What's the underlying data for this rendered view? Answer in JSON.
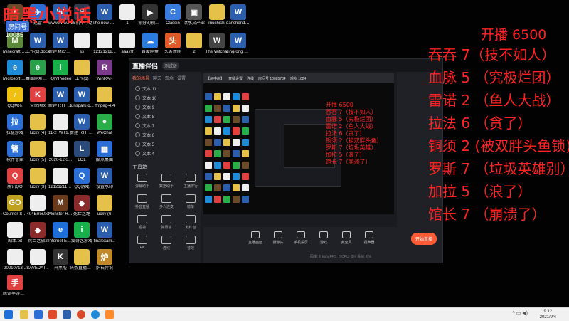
{
  "overlay": {
    "title": "暗黑小说话",
    "room_badge": "房间号",
    "room_number": "10085"
  },
  "scoreboard": {
    "header": "开播 6500",
    "rows": [
      "吞吞 7（技不如人）",
      "血脉 5 （究极烂团）",
      "雷诺 2 （鱼人大战）",
      "拉法 6 （贪了）",
      "铜须 2 (被双胖头鱼锁)",
      "罗斯 7 （垃圾英雄别）",
      "加拉 5 （浪了）",
      "馆长 7 （崩溃了）"
    ]
  },
  "desktop_icons": [
    {
      "label": "Thy Are Billions",
      "color": "#6b4a2a",
      "glyph": "T"
    },
    {
      "label": "迅雷",
      "color": "#2b6fd6",
      "glyph": "✈"
    },
    {
      "label": "wwwwww.d...",
      "color": "#2b5fae",
      "glyph": "W"
    },
    {
      "label": "65机甲行动",
      "color": "#2e3a4e",
      "glyph": "S"
    },
    {
      "label": "The new green rev...",
      "color": "#2b5fae",
      "glyph": "W"
    },
    {
      "label": "1",
      "color": "#eeeeee",
      "glyph": ""
    },
    {
      "label": "零分的视频实录.mp4",
      "color": "#333333",
      "glyph": "▶"
    },
    {
      "label": "Classin",
      "color": "#3a7be0",
      "glyph": "C"
    },
    {
      "label": "洪水文产业",
      "color": "#555555",
      "glyph": "▣"
    },
    {
      "label": "mushishi",
      "color": "#e6c14a",
      "glyph": ""
    },
    {
      "label": "danshendocx",
      "color": "#2b5fae",
      "glyph": "W"
    },
    {
      "label": "Minecraft Launcher",
      "color": "#5c8a3a",
      "glyph": "M"
    },
    {
      "label": "工作(1).docx",
      "color": "#2b5fae",
      "glyph": "W"
    },
    {
      "label": "新建 Microsoft ...",
      "color": "#2b5fae",
      "glyph": "W"
    },
    {
      "label": "ss",
      "color": "#eeeeee",
      "glyph": ""
    },
    {
      "label": "12121212...",
      "color": "#eeeeee",
      "glyph": ""
    },
    {
      "label": "aaa.rtf",
      "color": "#eeeeee",
      "glyph": ""
    },
    {
      "label": "百度网盘",
      "color": "#2b7be0",
      "glyph": "☁"
    },
    {
      "label": "头条新闻",
      "color": "#e05a2a",
      "glyph": "头"
    },
    {
      "label": "2",
      "color": "#e6c14a",
      "glyph": ""
    },
    {
      "label": "The Witcher",
      "color": "#444444",
      "glyph": "W"
    },
    {
      "label": "dingrong 2 xinyuansducs",
      "color": "#2b5fae",
      "glyph": "W"
    },
    {
      "label": "Microsoft Edge",
      "color": "#1f8ad8",
      "glyph": "e"
    },
    {
      "label": "毒霸网址大全",
      "color": "#2aa04a",
      "glyph": "e"
    },
    {
      "label": "IQIYI Video",
      "color": "#18b04a",
      "glyph": "i"
    },
    {
      "label": "工作(1)",
      "color": "#e6c14a",
      "glyph": ""
    },
    {
      "label": "WinRAR",
      "color": "#7a3a8a",
      "glyph": "R"
    },
    {
      "label": "QQ音乐",
      "color": "#f0c010",
      "glyph": "♪"
    },
    {
      "label": "全民K歌",
      "color": "#e04040",
      "glyph": "K"
    },
    {
      "label": "新建 RTF 文本文档",
      "color": "#2b5fae",
      "glyph": "W"
    },
    {
      "label": "funspark-q...",
      "color": "#2b5fae",
      "glyph": "W"
    },
    {
      "label": "ffmpeg-4.4",
      "color": "#e6c14a",
      "glyph": ""
    },
    {
      "label": "拉拔游戏",
      "color": "#2b6fd6",
      "glyph": "拉"
    },
    {
      "label": "lucky (4)",
      "color": "#e6c14a",
      "glyph": ""
    },
    {
      "label": "11-2_WT1_...",
      "color": "#eeeeee",
      "glyph": ""
    },
    {
      "label": "新建 RTF 文本文档",
      "color": "#2b5fae",
      "glyph": "W"
    },
    {
      "label": "WeChat",
      "color": "#2aae4a",
      "glyph": "●"
    },
    {
      "label": "软件管家",
      "color": "#2b6fd6",
      "glyph": "管"
    },
    {
      "label": "lucky (5)",
      "color": "#e6c14a",
      "glyph": ""
    },
    {
      "label": "2020-12-3...",
      "color": "#eeeeee",
      "glyph": ""
    },
    {
      "label": "LOL",
      "color": "#2a4a7a",
      "glyph": "L"
    },
    {
      "label": "酷点桌面",
      "color": "#2b6fd6",
      "glyph": "▦"
    },
    {
      "label": "腾讯QQ",
      "color": "#e04040",
      "glyph": "Q"
    },
    {
      "label": "lucky (3)",
      "color": "#e6c14a",
      "glyph": ""
    },
    {
      "label": "121212112...",
      "color": "#eeeeee",
      "glyph": ""
    },
    {
      "label": "QQ游戏",
      "color": "#2b6fd6",
      "glyph": "Q"
    },
    {
      "label": "设置水印",
      "color": "#2b5fae",
      "glyph": "W"
    },
    {
      "label": "Counter-S... Global Off...",
      "color": "#c0a020",
      "glyph": "GO"
    },
    {
      "label": "404Error.txt",
      "color": "#eeeeee",
      "glyph": ""
    },
    {
      "label": "Monster Hunter...",
      "color": "#6a3a1a",
      "glyph": "M"
    },
    {
      "label": "死亡之路",
      "color": "#8a2a2a",
      "glyph": "◆"
    },
    {
      "label": "lucky (6)",
      "color": "#e6c14a",
      "glyph": ""
    },
    {
      "label": "剧本.txt",
      "color": "#eeeeee",
      "glyph": ""
    },
    {
      "label": "死亡之旅2",
      "color": "#8a2a2a",
      "glyph": "◆"
    },
    {
      "label": "Internet Explorer",
      "color": "#1f6fd8",
      "glyph": "e"
    },
    {
      "label": "爱奇艺游戏",
      "color": "#18b04a",
      "glyph": "i"
    },
    {
      "label": "finalexam...",
      "color": "#2b5fae",
      "glyph": "W"
    },
    {
      "label": "20210713...",
      "color": "#eeeeee",
      "glyph": ""
    },
    {
      "label": "SAVEDAT...",
      "color": "#eeeeee",
      "glyph": ""
    },
    {
      "label": "开黑啦",
      "color": "#333333",
      "glyph": "K"
    },
    {
      "label": "头条直播工具",
      "color": "#e6c14a",
      "glyph": ""
    },
    {
      "label": "炉石传说",
      "color": "#c08a2a",
      "glyph": "炉"
    },
    {
      "label": "腾讯手游助手",
      "color": "#e04040",
      "glyph": "手"
    }
  ],
  "app": {
    "logo": "直播伴侣",
    "version": "测试版",
    "tabs": [
      "我的场景",
      "聊天",
      "观众",
      "设置"
    ],
    "scenes": [
      "文本 11",
      "文本 10",
      "文本 9",
      "文本 8",
      "文本 7",
      "文本 6",
      "文本 5",
      "文本 4"
    ],
    "toolbox_title": "工具箱",
    "tools": [
      "弹幕助手",
      "数据助手",
      "主播排行",
      "抖音直播",
      "多人连麦",
      "榜单",
      "福袋",
      "弹幕墙",
      "发红包",
      "PK",
      "连线",
      "音效"
    ],
    "preview_bar": [
      "【画中画】",
      "直播设置",
      "连线",
      "房间号 10085734",
      "观众 1024"
    ],
    "nested_board": [
      "开播 6500",
      "吞吞 7（技不如人）",
      "血脉 5（究极烂团）",
      "雷诺 2（鱼人大战）",
      "拉法 6（贪了）",
      "铜须 2（被双胖头鱼）",
      "罗斯 7（垃圾英雄）",
      "加拉 5（浪了）",
      "馆长 7（崩溃了）"
    ],
    "controls": [
      "直播画面",
      "摄像头",
      "手机投屏",
      "游戏",
      "麦克风",
      "扬声器"
    ],
    "start_live": "开始直播",
    "status": "码率: 0 kb/s   FPS: 0   CPU: 0%   丢帧: 0%"
  },
  "taskbar": {
    "time": "9:12",
    "date": "2021/9/4"
  }
}
